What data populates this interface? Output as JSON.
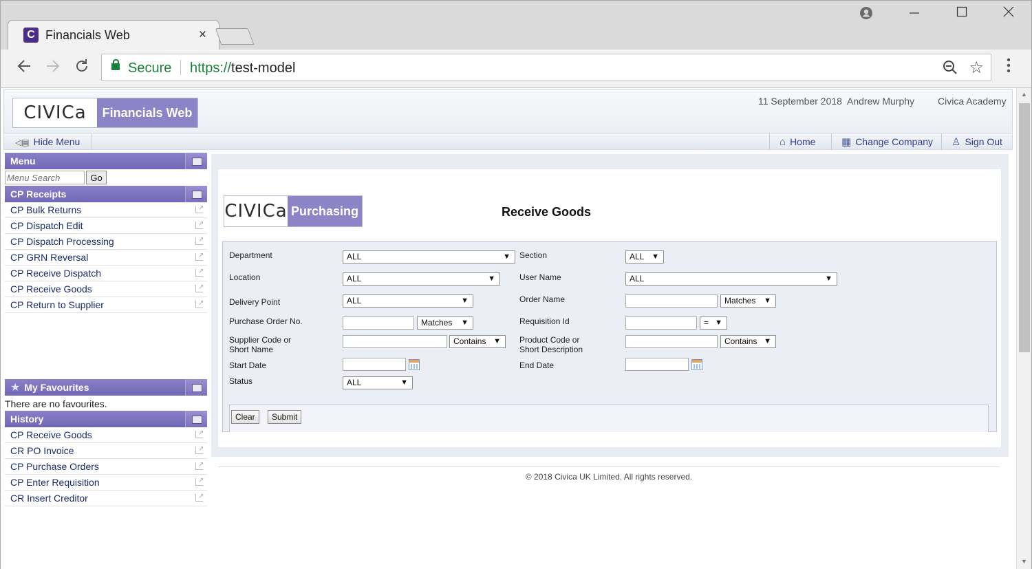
{
  "browser": {
    "tab_title": "Financials Web",
    "favicon_letter": "C",
    "tab_close": "×",
    "secure_label": "Secure",
    "url_scheme": "https://",
    "url_host": "test-model"
  },
  "header": {
    "logo_word": "CIVICa",
    "logo_app": "Financials Web",
    "date": "11 September 2018",
    "user": "Andrew Murphy",
    "company": "Civica Academy"
  },
  "nav": {
    "hide_menu": "Hide Menu",
    "home": "Home",
    "change_company": "Change Company",
    "sign_out": "Sign Out"
  },
  "sidebar": {
    "menu_title": "Menu",
    "search_placeholder": "Menu Search",
    "go_label": "Go",
    "receipts_title": "CP Receipts",
    "receipts_items": [
      "CP Bulk Returns",
      "CP Dispatch Edit",
      "CP Dispatch Processing",
      "CP GRN Reversal",
      "CP Receive Dispatch",
      "CP Receive Goods",
      "CP Return to Supplier"
    ],
    "favourites_title": "My Favourites",
    "favourites_empty": "There are no favourites.",
    "history_title": "History",
    "history_items": [
      "CP Receive Goods",
      "CR PO Invoice",
      "CP Purchase Orders",
      "CP Enter Requisition",
      "CR Insert Creditor"
    ]
  },
  "main": {
    "logo_word": "CIVICa",
    "logo_app": "Purchasing",
    "title": "Receive Goods",
    "form": {
      "department_label": "Department",
      "department_value": "ALL",
      "section_label": "Section",
      "section_value": "ALL",
      "location_label": "Location",
      "location_value": "ALL",
      "username_label": "User Name",
      "username_value": "ALL",
      "delivery_label": "Delivery Point",
      "delivery_value": "ALL",
      "order_name_label": "Order Name",
      "order_name_match": "Matches",
      "po_label": "Purchase Order No.",
      "po_match": "Matches",
      "req_label": "Requisition Id",
      "req_match": "=",
      "supplier_label_1": "Supplier Code or",
      "supplier_label_2": "Short Name",
      "supplier_match": "Contains",
      "product_label_1": "Product Code or",
      "product_label_2": "Short Description",
      "product_match": "Contains",
      "start_date_label": "Start Date",
      "end_date_label": "End Date",
      "status_label": "Status",
      "status_value": "ALL"
    },
    "clear_label": "Clear",
    "submit_label": "Submit"
  },
  "footer": "© 2018 Civica UK Limited. All rights reserved.",
  "colors": {
    "brand_purple": "#8d84c8",
    "header_purple": "#7267b6",
    "link_blue": "#2a3f8f",
    "secure_green": "#188038"
  }
}
